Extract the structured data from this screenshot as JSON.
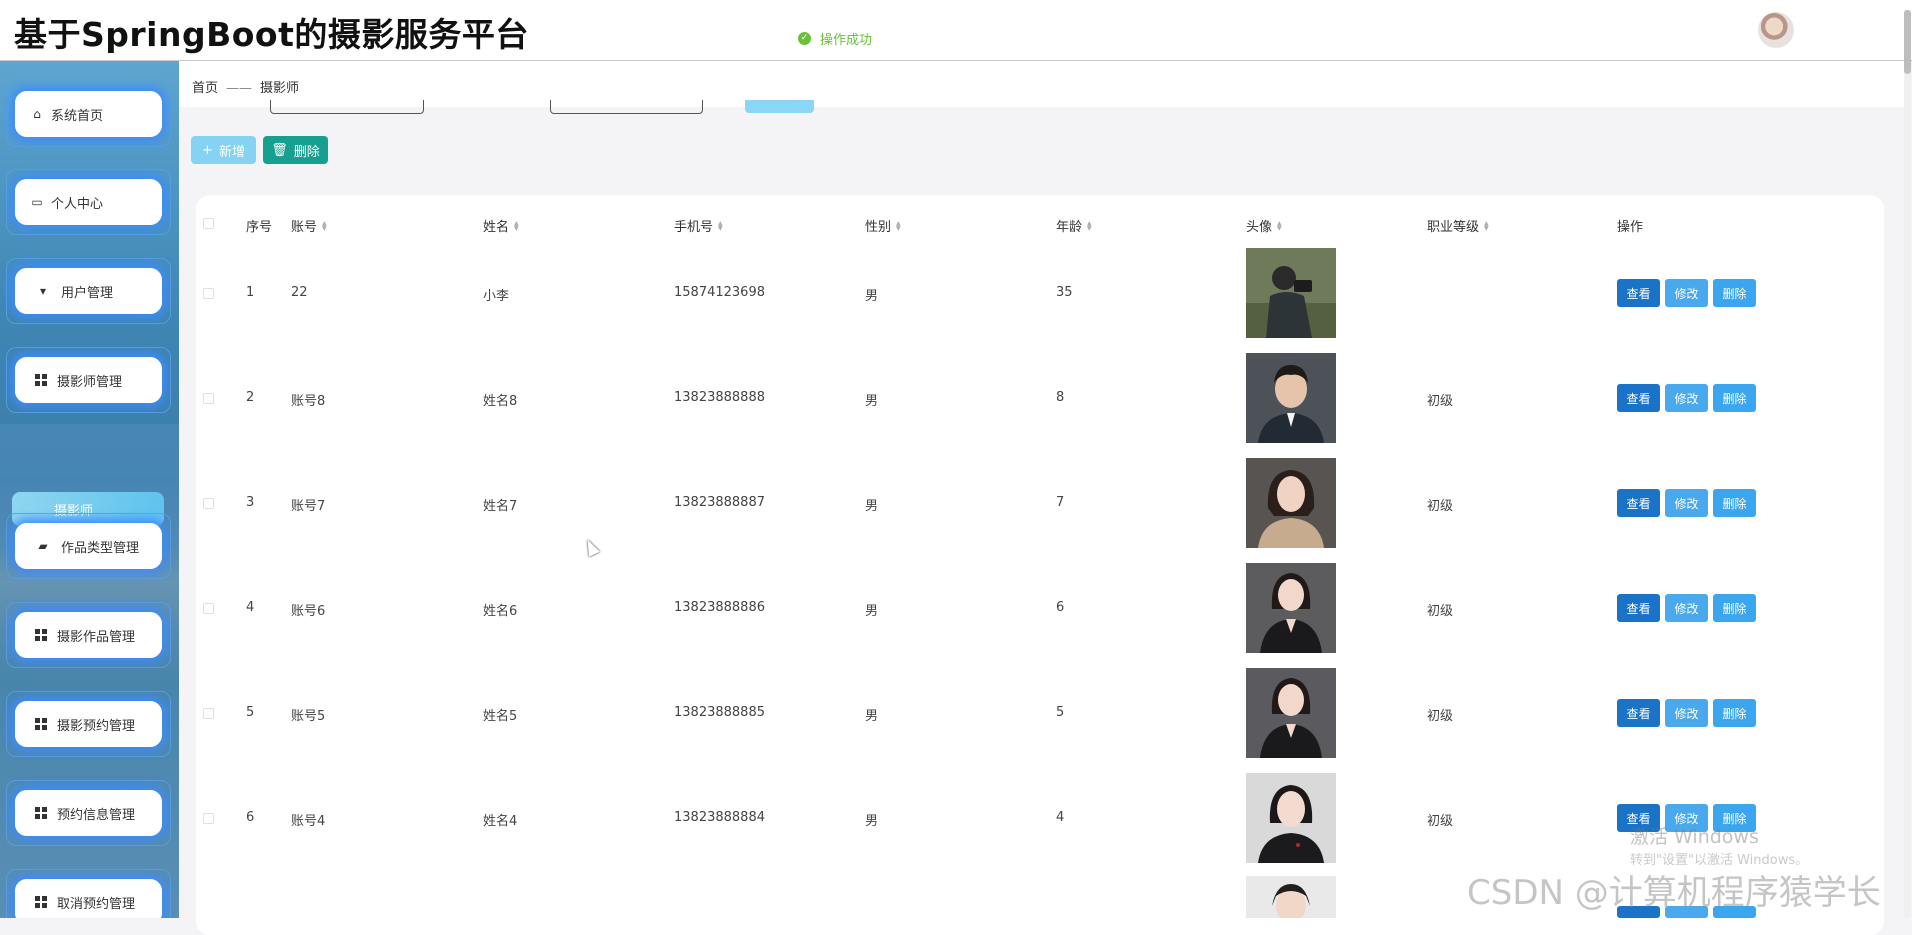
{
  "header": {
    "app_title": "基于SpringBoot的摄影服务平台",
    "toast": "操作成功",
    "avatar_icon": "user-avatar"
  },
  "sidebar": {
    "items": [
      {
        "label": "系统首页",
        "icon": "home-icon"
      },
      {
        "label": "个人中心",
        "icon": "profile-icon"
      },
      {
        "label": "用户管理",
        "icon": "user-icon"
      },
      {
        "label": "摄影师管理",
        "icon": "grid-icon"
      },
      {
        "label": "作品类型管理",
        "icon": "folder-icon"
      },
      {
        "label": "摄影作品管理",
        "icon": "grid-icon"
      },
      {
        "label": "摄影预约管理",
        "icon": "grid-icon"
      },
      {
        "label": "预约信息管理",
        "icon": "grid-icon"
      },
      {
        "label": "取消预约管理",
        "icon": "grid-icon"
      }
    ],
    "submenu_active": "摄影师"
  },
  "breadcrumb": {
    "home": "首页",
    "separator": "——",
    "current": "摄影师"
  },
  "toolbar": {
    "add_label": "新增",
    "delete_label": "删除"
  },
  "table": {
    "columns": [
      "序号",
      "账号",
      "姓名",
      "手机号",
      "性别",
      "年龄",
      "头像",
      "职业等级",
      "操作"
    ],
    "actions": {
      "view": "查看",
      "edit": "修改",
      "delete": "删除"
    },
    "rows": [
      {
        "index": "1",
        "account": "22",
        "name": "小李",
        "phone": "15874123698",
        "gender": "男",
        "age": "35",
        "level": ""
      },
      {
        "index": "2",
        "account": "账号8",
        "name": "姓名8",
        "phone": "13823888888",
        "gender": "男",
        "age": "8",
        "level": "初级"
      },
      {
        "index": "3",
        "account": "账号7",
        "name": "姓名7",
        "phone": "13823888887",
        "gender": "男",
        "age": "7",
        "level": "初级"
      },
      {
        "index": "4",
        "account": "账号6",
        "name": "姓名6",
        "phone": "13823888886",
        "gender": "男",
        "age": "6",
        "level": "初级"
      },
      {
        "index": "5",
        "account": "账号5",
        "name": "姓名5",
        "phone": "13823888885",
        "gender": "男",
        "age": "5",
        "level": "初级"
      },
      {
        "index": "6",
        "account": "账号4",
        "name": "姓名4",
        "phone": "13823888884",
        "gender": "男",
        "age": "4",
        "level": "初级"
      }
    ],
    "partial_row_actions": {
      "view": "查看",
      "edit": "修改",
      "delete": "删除"
    }
  },
  "overlays": {
    "windows_activate": "激活 Windows",
    "windows_activate_hint": "转到\"设置\"以激活 Windows。",
    "csdn_watermark": "CSDN @计算机程序猿学长"
  },
  "colors": {
    "accent_primary": "#1a73c7",
    "accent_light": "#4aa8ec",
    "add_button": "#86d2f3",
    "delete_button": "#17a08f",
    "success": "#67c23a"
  }
}
